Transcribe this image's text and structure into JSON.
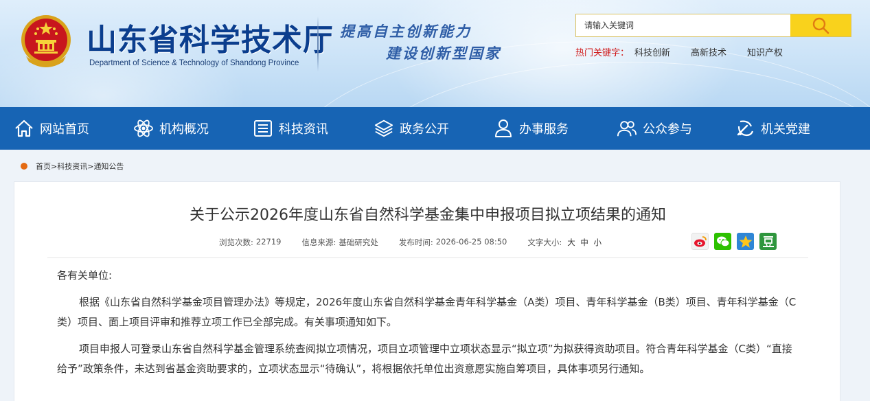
{
  "header": {
    "org_name_cn": "山东省科学技术厅",
    "org_name_en": "Department of Science & Technology of Shandong Province",
    "slogan_line1": "提高自主创新能力",
    "slogan_line2": "建设创新型国家",
    "search": {
      "placeholder": "请输入关键词"
    },
    "hot_keywords": {
      "label": "热门关键字：",
      "items": [
        "科技创新",
        "高新技术",
        "知识产权"
      ]
    }
  },
  "nav": {
    "items": [
      {
        "label": "网站首页",
        "icon": "home-icon"
      },
      {
        "label": "机构概况",
        "icon": "atom-icon"
      },
      {
        "label": "科技资讯",
        "icon": "news-icon"
      },
      {
        "label": "政务公开",
        "icon": "layers-icon"
      },
      {
        "label": "办事服务",
        "icon": "user-service-icon"
      },
      {
        "label": "公众参与",
        "icon": "users-icon"
      },
      {
        "label": "机关党建",
        "icon": "party-emblem-icon"
      }
    ]
  },
  "breadcrumb": {
    "items": [
      "首页",
      "科技资讯",
      "通知公告"
    ],
    "separator": ">"
  },
  "article": {
    "title": "关于公示2026年度山东省自然科学基金集中申报项目拟立项结果的通知",
    "views_label": "浏览次数:",
    "views": "22719",
    "source_label": "信息来源:",
    "source": "基础研究处",
    "date_label": "发布时间:",
    "date": "2026-06-25 08:50",
    "fontsize_label": "文字大小:",
    "fontsize_options": [
      "大",
      "中",
      "小"
    ],
    "share_icons": [
      "weibo-icon",
      "wechat-icon",
      "qzone-icon",
      "douban-icon"
    ],
    "salutation": "各有关单位:",
    "paragraph1": "根据《山东省自然科学基金项目管理办法》等规定，2026年度山东省自然科学基金青年科学基金（A类）项目、青年科学基金（B类）项目、青年科学基金（C类）项目、面上项目评审和推荐立项工作已全部完成。有关事项通知如下。",
    "paragraph2": "项目申报人可登录山东省自然科学基金管理系统查阅拟立项情况，项目立项管理中立项状态显示“拟立项”为拟获得资助项目。符合青年科学基金（C类）“直接给予”政策条件，未达到省基金资助要求的，立项状态显示“待确认”，将根据依托单位出资意愿实施自筹项目，具体事项另行通知。"
  },
  "colors": {
    "nav_bg": "#1764b4",
    "title_blue": "#0b3e8e",
    "search_button": "#f9d21c",
    "hot_label_red": "#d01a1a",
    "breadcrumb_dot": "#e46a13"
  }
}
